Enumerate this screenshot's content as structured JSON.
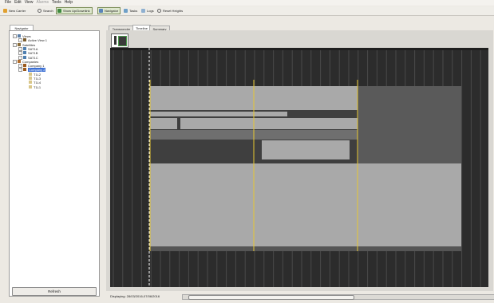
{
  "menu": [
    "File",
    "Edit",
    "View",
    "Alarms",
    "Tools",
    "Help"
  ],
  "toolbar": {
    "new_carrier": "New Carrier",
    "search": "Search",
    "show_updownlink": "Show Up/Downlink",
    "navigator": "Navigator",
    "tasks": "Tasks",
    "logs": "Logs",
    "reset_heights": "Reset Heights"
  },
  "navigator": {
    "tab": "Navigator",
    "tree": [
      {
        "label": "Views",
        "level": 1,
        "icon": "eye-icon"
      },
      {
        "label": "Active View 1",
        "level": 2,
        "icon": "view-icon"
      },
      {
        "label": "Satellites",
        "level": 1,
        "icon": "satellite-folder-icon"
      },
      {
        "label": "SAT1A",
        "level": 2,
        "icon": "satellite-icon"
      },
      {
        "label": "SAT1B",
        "level": 2,
        "icon": "satellite-icon"
      },
      {
        "label": "SAT1C",
        "level": 2,
        "icon": "satellite-icon"
      },
      {
        "label": "Companies",
        "level": 1,
        "icon": "company-folder-icon"
      },
      {
        "label": "Company 1",
        "level": 2,
        "icon": "company-icon"
      },
      {
        "label": "Company 2",
        "level": 2,
        "icon": "company-icon",
        "selected": true
      },
      {
        "label": "T1L2",
        "level": 3,
        "icon": "transponder-icon"
      },
      {
        "label": "T1L3",
        "level": 3,
        "icon": "transponder-icon"
      },
      {
        "label": "T1L4",
        "level": 3,
        "icon": "transponder-icon"
      },
      {
        "label": "T1L1",
        "level": 3,
        "icon": "transponder-icon"
      }
    ],
    "refresh": "Refresh"
  },
  "tabs": [
    {
      "label": "Transponder",
      "selected": false
    },
    {
      "label": "Timeline",
      "selected": true
    },
    {
      "label": "Summary",
      "selected": false
    }
  ],
  "status": "Displaying: 28/03/2016-07/06/2016",
  "colors": {
    "background": "#2c2c2c",
    "block": "#a9a9a9",
    "block_dark": "#6f6f6f",
    "marker": "#e8c832",
    "now_line": "#ffffff",
    "selected": "#3b6fd4",
    "active_button": "#dfe8cf"
  }
}
